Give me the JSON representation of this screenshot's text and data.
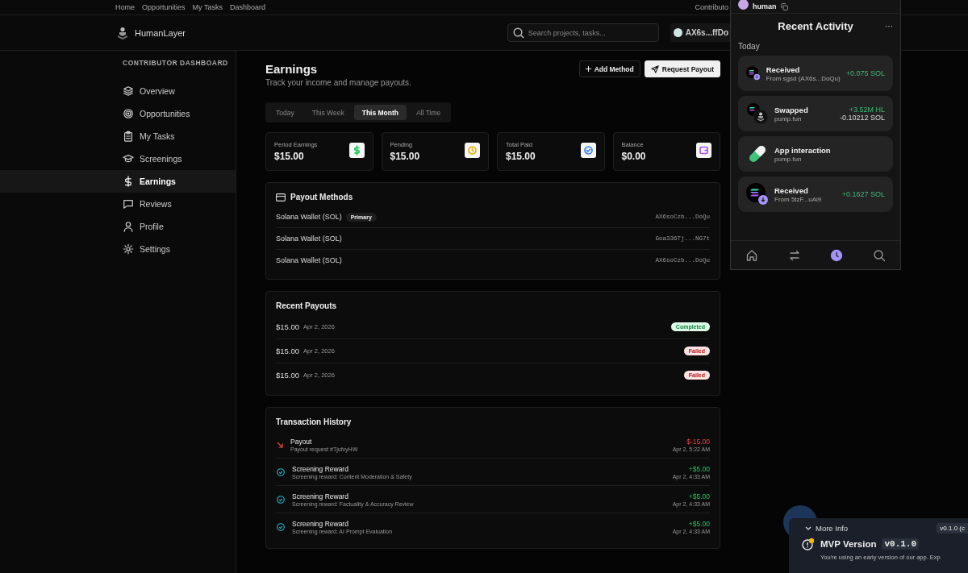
{
  "top_nav": {
    "links": [
      "Home",
      "Opportunities",
      "My Tasks",
      "Dashboard"
    ],
    "right_link": "Contributo"
  },
  "header": {
    "brand": "HumanLayer",
    "search": {
      "placeholder": "Search projects, tasks..."
    },
    "wallet": "AX6s...ffDo"
  },
  "sidebar": {
    "title": "CONTRIBUTOR DASHBOARD",
    "items": [
      {
        "label": "Overview",
        "selected": false
      },
      {
        "label": "Opportunities",
        "selected": false
      },
      {
        "label": "My Tasks",
        "selected": false
      },
      {
        "label": "Screenings",
        "selected": false
      },
      {
        "label": "Earnings",
        "selected": true
      },
      {
        "label": "Reviews",
        "selected": false
      },
      {
        "label": "Profile",
        "selected": false
      },
      {
        "label": "Settings",
        "selected": false
      }
    ]
  },
  "page": {
    "title": "Earnings",
    "subtitle": "Track your income and manage payouts.",
    "buttons": {
      "add": "Add Method",
      "request": "Request Payout"
    }
  },
  "tabs": [
    {
      "label": "Today",
      "selected": false
    },
    {
      "label": "This Week",
      "selected": false
    },
    {
      "label": "This Month",
      "selected": true
    },
    {
      "label": "All Time",
      "selected": false
    }
  ],
  "stats": [
    {
      "label": "Period Earnings",
      "value": "$15.00",
      "color": "#22c55e"
    },
    {
      "label": "Pending",
      "value": "$15.00",
      "color": "#eab308"
    },
    {
      "label": "Total Paid",
      "value": "$15.00",
      "color": "#3b82f6"
    },
    {
      "label": "Balance",
      "value": "$0.00",
      "color": "#a855f7"
    }
  ],
  "payout_methods": {
    "title": "Payout Methods",
    "items": [
      {
        "name": "Solana Wallet (SOL)",
        "badge": "Primary",
        "address": "AX6soCzb...DoQu"
      },
      {
        "name": "Solana Wallet (SOL)",
        "address": "Goa336Tj...NG7t"
      },
      {
        "name": "Solana Wallet (SOL)",
        "address": "AX6soCzb...DoQu"
      }
    ]
  },
  "recent_payouts": {
    "title": "Recent Payouts",
    "items": [
      {
        "amount": "$15.00",
        "date": "Apr 2, 2026",
        "status": "Completed",
        "kind": "completed"
      },
      {
        "amount": "$15.00",
        "date": "Apr 2, 2026",
        "status": "Failed",
        "kind": "failed"
      },
      {
        "amount": "$15.00",
        "date": "Apr 2, 2026",
        "status": "Failed",
        "kind": "failed"
      }
    ]
  },
  "transactions": {
    "title": "Transaction History",
    "items": [
      {
        "kind": "payout",
        "title": "Payout",
        "detail": "Payout request #TjufvyHW",
        "amount": "$-15.00",
        "time": "Apr 2, 5:22 AM"
      },
      {
        "kind": "reward",
        "title": "Screening Reward",
        "detail": "Screening reward: Content Moderation & Safety",
        "amount": "+$5.00",
        "time": "Apr 2, 4:33 AM"
      },
      {
        "kind": "reward",
        "title": "Screening Reward",
        "detail": "Screening reward: Factuality & Accuracy Review",
        "amount": "+$5.00",
        "time": "Apr 2, 4:33 AM"
      },
      {
        "kind": "reward",
        "title": "Screening Reward",
        "detail": "Screening reward: AI Prompt Evaluation",
        "amount": "+$5.00",
        "time": "Apr 2, 4:33 AM"
      }
    ]
  },
  "wallet_popup": {
    "account": "human",
    "title": "Recent Activity",
    "more": "···",
    "section": "Today",
    "activities": [
      {
        "kind": "received",
        "title": "Received",
        "subtitle": "From sgsd (AX6s...DoQu)",
        "amounts": [
          "+0.075 SOL"
        ]
      },
      {
        "kind": "swapped",
        "title": "Swapped",
        "subtitle": "pump.fun",
        "amounts": [
          "+3.52M HL",
          "-0.10212 SOL"
        ]
      },
      {
        "kind": "app",
        "title": "App interaction",
        "subtitle": "pump.fun"
      },
      {
        "kind": "received",
        "title": "Received",
        "subtitle": "From 5tzF...uAi9",
        "amounts": [
          "+0.1627 SOL"
        ]
      }
    ],
    "nav": [
      {
        "selected": false
      },
      {
        "selected": false
      },
      {
        "selected": true
      },
      {
        "selected": false
      }
    ]
  },
  "mvp_panel": {
    "toggle": "More Info",
    "version_badge": "v0.1.0 (c",
    "title": "MVP Version",
    "code": "v0.1.0",
    "text": "You're using an early version of our app. Exp"
  }
}
